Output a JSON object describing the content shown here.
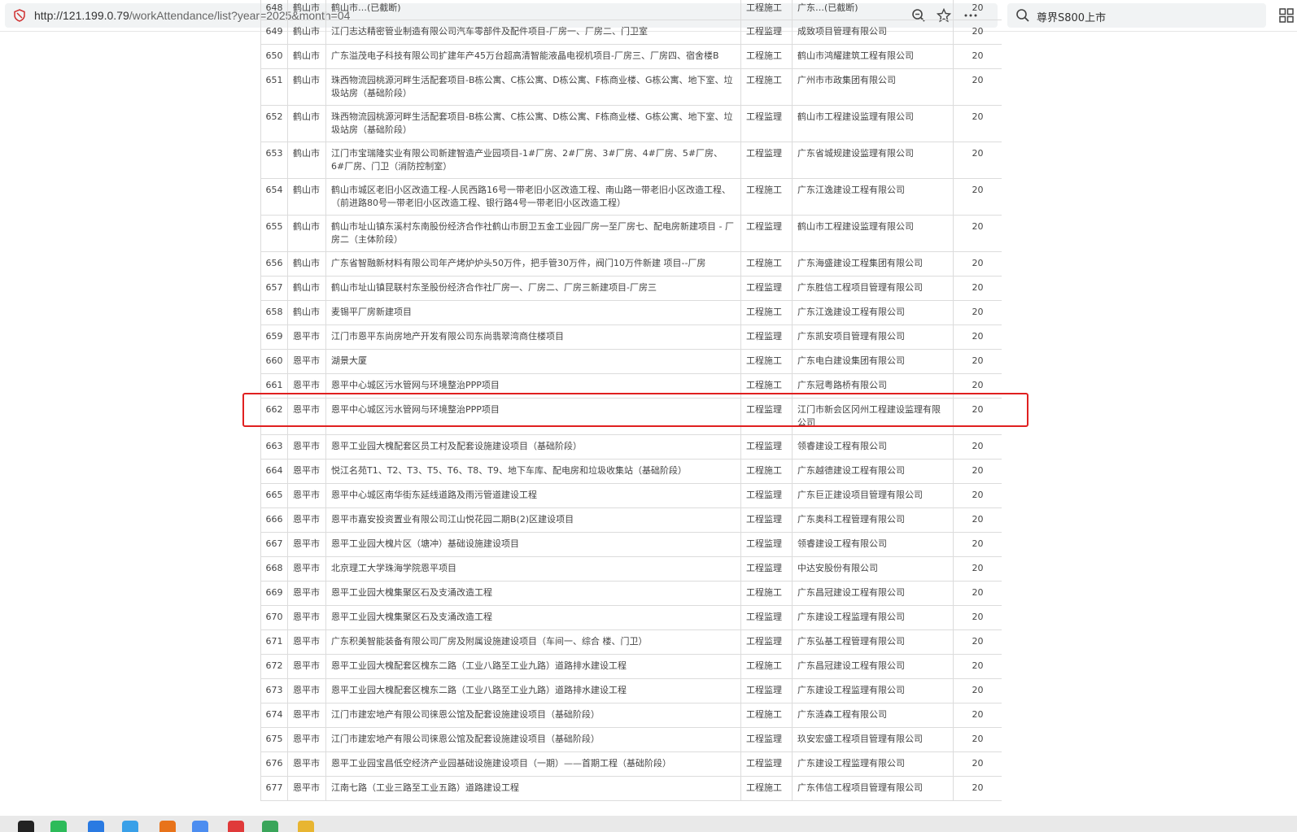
{
  "browser": {
    "url_host": "http://121.199.0.79",
    "url_path": "/workAttendance/list?year=2025&month=04",
    "search_text": "尊界S800上市"
  },
  "table": {
    "partial_top_row": [
      "648",
      "鹤山市",
      "鹤山市…(已截断)",
      "工程施工",
      "广东…(已截断)",
      "20"
    ],
    "rows": [
      {
        "no": "649",
        "city": "鹤山市",
        "project": "江门志达精密管业制造有限公司汽车零部件及配件项目-厂房一、厂房二、门卫室",
        "type": "工程监理",
        "company": "成致项目管理有限公司",
        "days": "20"
      },
      {
        "no": "650",
        "city": "鹤山市",
        "project": "广东溢茂电子科技有限公司扩建年产45万台超高清智能液晶电视机项目-厂房三、厂房四、宿舍楼B",
        "type": "工程施工",
        "company": "鹤山市鸿耀建筑工程有限公司",
        "days": "20"
      },
      {
        "no": "651",
        "city": "鹤山市",
        "project": "珠西物流园桃源河畔生活配套项目-B栋公寓、C栋公寓、D栋公寓、F栋商业楼、G栋公寓、地下室、垃圾站房（基础阶段）",
        "type": "工程施工",
        "company": "广州市市政集团有限公司",
        "days": "20"
      },
      {
        "no": "652",
        "city": "鹤山市",
        "project": "珠西物流园桃源河畔生活配套项目-B栋公寓、C栋公寓、D栋公寓、F栋商业楼、G栋公寓、地下室、垃圾站房（基础阶段）",
        "type": "工程监理",
        "company": "鹤山市工程建设监理有限公司",
        "days": "20"
      },
      {
        "no": "653",
        "city": "鹤山市",
        "project": "江门市宝瑞隆实业有限公司新建智造产业园项目-1#厂房、2#厂房、3#厂房、4#厂房、5#厂房、6#厂房、门卫（消防控制室）",
        "type": "工程监理",
        "company": "广东省城规建设监理有限公司",
        "days": "20"
      },
      {
        "no": "654",
        "city": "鹤山市",
        "project": "鹤山市城区老旧小区改造工程-人民西路16号一带老旧小区改造工程、南山路一带老旧小区改造工程、（前进路80号一带老旧小区改造工程、银行路4号一带老旧小区改造工程）",
        "type": "工程施工",
        "company": "广东江逸建设工程有限公司",
        "days": "20"
      },
      {
        "no": "655",
        "city": "鹤山市",
        "project": "鹤山市址山镇东溪村东南股份经济合作社鹤山市厨卫五金工业园厂房一至厂房七、配电房新建项目 - 厂房二（主体阶段）",
        "type": "工程监理",
        "company": "鹤山市工程建设监理有限公司",
        "days": "20"
      },
      {
        "no": "656",
        "city": "鹤山市",
        "project": "广东省智融新材料有限公司年产烤炉炉头50万件，把手管30万件，阀门10万件新建 项目--厂房",
        "type": "工程施工",
        "company": "广东海盛建设工程集团有限公司",
        "days": "20"
      },
      {
        "no": "657",
        "city": "鹤山市",
        "project": "鹤山市址山镇昆联村东圣股份经济合作社厂房一、厂房二、厂房三新建项目-厂房三",
        "type": "工程监理",
        "company": "广东胜信工程项目管理有限公司",
        "days": "20"
      },
      {
        "no": "658",
        "city": "鹤山市",
        "project": "麦锡平厂房新建项目",
        "type": "工程施工",
        "company": "广东江逸建设工程有限公司",
        "days": "20"
      },
      {
        "no": "659",
        "city": "恩平市",
        "project": "江门市恩平东尚房地产开发有限公司东尚翡翠湾商住楼项目",
        "type": "工程监理",
        "company": "广东凯安项目管理有限公司",
        "days": "20"
      },
      {
        "no": "660",
        "city": "恩平市",
        "project": "湖景大厦",
        "type": "工程施工",
        "company": "广东电白建设集团有限公司",
        "days": "20"
      },
      {
        "no": "661",
        "city": "恩平市",
        "project": "恩平中心城区污水管网与环境整治PPP项目",
        "type": "工程施工",
        "company": "广东冠粤路桥有限公司",
        "days": "20"
      },
      {
        "no": "662",
        "city": "恩平市",
        "project": "恩平中心城区污水管网与环境整治PPP项目",
        "type": "工程监理",
        "company": "江门市新会区冈州工程建设监理有限公司",
        "days": "20"
      },
      {
        "no": "663",
        "city": "恩平市",
        "project": "恩平工业园大槐配套区员工村及配套设施建设项目（基础阶段）",
        "type": "工程监理",
        "company": "领睿建设工程有限公司",
        "days": "20"
      },
      {
        "no": "664",
        "city": "恩平市",
        "project": "悦江名苑T1、T2、T3、T5、T6、T8、T9、地下车库、配电房和垃圾收集站（基础阶段）",
        "type": "工程施工",
        "company": "广东越德建设工程有限公司",
        "days": "20"
      },
      {
        "no": "665",
        "city": "恩平市",
        "project": "恩平中心城区南华街东延线道路及雨污管道建设工程",
        "type": "工程监理",
        "company": "广东巨正建设项目管理有限公司",
        "days": "20"
      },
      {
        "no": "666",
        "city": "恩平市",
        "project": "恩平市嘉安投资置业有限公司江山悦花园二期B(2)区建设项目",
        "type": "工程监理",
        "company": "广东奥科工程管理有限公司",
        "days": "20"
      },
      {
        "no": "667",
        "city": "恩平市",
        "project": "恩平工业园大槐片区（塘冲）基础设施建设项目",
        "type": "工程监理",
        "company": "领睿建设工程有限公司",
        "days": "20"
      },
      {
        "no": "668",
        "city": "恩平市",
        "project": "北京理工大学珠海学院恩平项目",
        "type": "工程监理",
        "company": "中达安股份有限公司",
        "days": "20"
      },
      {
        "no": "669",
        "city": "恩平市",
        "project": "恩平工业园大槐集聚区石及支涌改造工程",
        "type": "工程施工",
        "company": "广东昌冠建设工程有限公司",
        "days": "20"
      },
      {
        "no": "670",
        "city": "恩平市",
        "project": "恩平工业园大槐集聚区石及支涌改造工程",
        "type": "工程监理",
        "company": "广东建设工程监理有限公司",
        "days": "20"
      },
      {
        "no": "671",
        "city": "恩平市",
        "project": "广东积美智能装备有限公司厂房及附属设施建设项目（车间一、综合 楼、门卫）",
        "type": "工程监理",
        "company": "广东弘基工程管理有限公司",
        "days": "20"
      },
      {
        "no": "672",
        "city": "恩平市",
        "project": "恩平工业园大槐配套区槐东二路（工业八路至工业九路）道路排水建设工程",
        "type": "工程施工",
        "company": "广东昌冠建设工程有限公司",
        "days": "20"
      },
      {
        "no": "673",
        "city": "恩平市",
        "project": "恩平工业园大槐配套区槐东二路（工业八路至工业九路）道路排水建设工程",
        "type": "工程监理",
        "company": "广东建设工程监理有限公司",
        "days": "20"
      },
      {
        "no": "674",
        "city": "恩平市",
        "project": "江门市建宏地产有限公司徕恩公馆及配套设施建设项目（基础阶段）",
        "type": "工程施工",
        "company": "广东涟森工程有限公司",
        "days": "20"
      },
      {
        "no": "675",
        "city": "恩平市",
        "project": "江门市建宏地产有限公司徕恩公馆及配套设施建设项目（基础阶段）",
        "type": "工程监理",
        "company": "玖安宏盛工程项目管理有限公司",
        "days": "20"
      },
      {
        "no": "676",
        "city": "恩平市",
        "project": "恩平工业园宝昌低空经济产业园基础设施建设项目（一期）——首期工程（基础阶段）",
        "type": "工程监理",
        "company": "广东建设工程监理有限公司",
        "days": "20"
      },
      {
        "no": "677",
        "city": "恩平市",
        "project": "江南七路（工业三路至工业五路）道路建设工程",
        "type": "工程施工",
        "company": "广东伟信工程项目管理有限公司",
        "days": "20"
      }
    ],
    "tall_rows": [
      "651",
      "652",
      "653",
      "654",
      "655",
      "662"
    ]
  },
  "colors": {
    "highlight_border": "#e02020",
    "table_border": "#dcdcdc",
    "address_bar_bg": "#f1f3f4"
  },
  "taskbar": {
    "icons": [
      "qq-icon",
      "wechat-icon",
      "send-icon",
      "app-icon",
      "browser-orange-icon",
      "browser-360-icon",
      "files-red-icon",
      "wps-green-icon",
      "folder-icon"
    ]
  }
}
